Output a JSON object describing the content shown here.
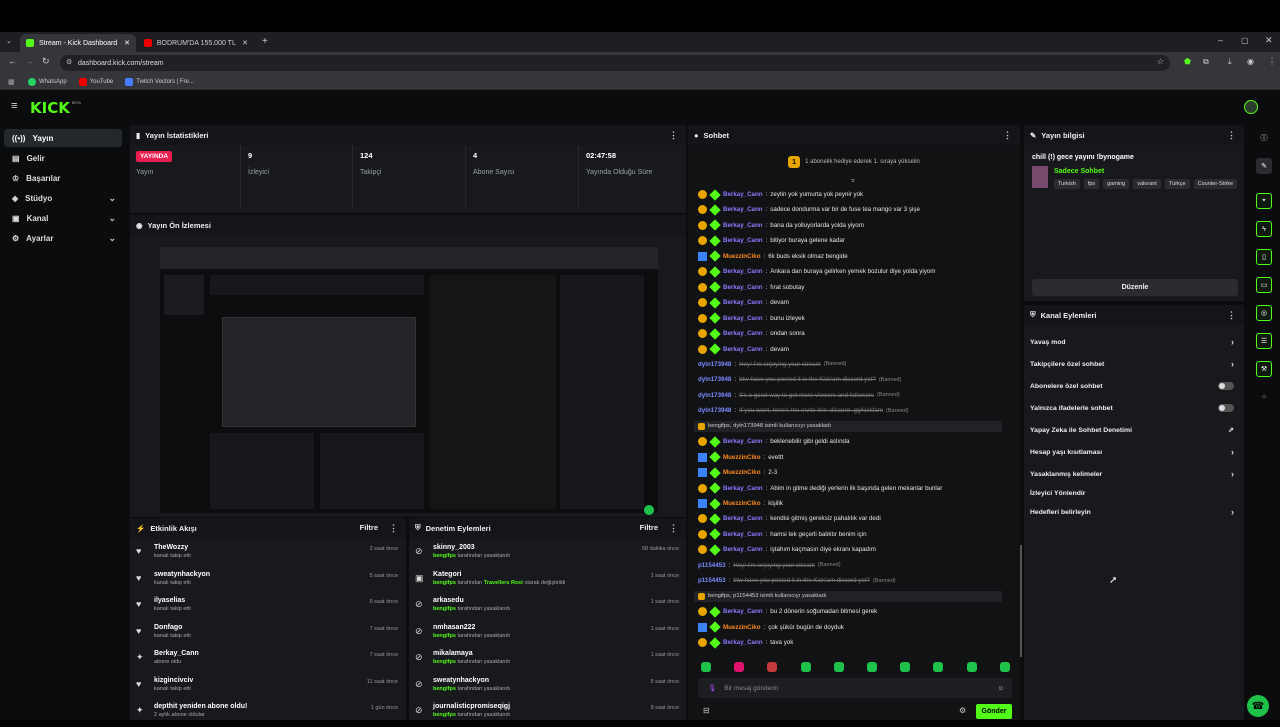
{
  "browser": {
    "tabs": [
      {
        "title": "Stream - Kick Dashboard"
      },
      {
        "title": "BODRUM'DA 155.000 TL HESA..."
      }
    ],
    "url": "dashboard.kick.com/stream",
    "bookmarks": [
      "WhatsApp",
      "YouTube",
      "Twitch Vectors | Fre..."
    ]
  },
  "app": {
    "logo": "KICK",
    "logo_badge": "BETA"
  },
  "sidebar": {
    "items": [
      {
        "label": "Yayın",
        "icon": "radio-icon",
        "active": true
      },
      {
        "label": "Gelir",
        "icon": "wallet-icon"
      },
      {
        "label": "Başarılar",
        "icon": "trophy-icon"
      },
      {
        "label": "Stüdyo",
        "icon": "studio-icon",
        "chevron": true
      },
      {
        "label": "Kanal",
        "icon": "channel-icon",
        "chevron": true
      },
      {
        "label": "Ayarlar",
        "icon": "gear-icon",
        "chevron": true
      }
    ]
  },
  "stats": {
    "title": "Yayın İstatistikleri",
    "items": [
      {
        "value": "YAYINDA",
        "label": "Yayın"
      },
      {
        "value": "9",
        "label": "İzleyici"
      },
      {
        "value": "124",
        "label": "Takipçi"
      },
      {
        "value": "4",
        "label": "Abone Sayısı"
      },
      {
        "value": "02:47:58",
        "label": "Yayında Olduğu Süre"
      }
    ]
  },
  "preview": {
    "title": "Yayın Ön İzlemesi"
  },
  "activity": {
    "title": "Etkinlik Akışı",
    "filter": "Filtre",
    "items": [
      {
        "name": "TheWozzy",
        "sub": "kanalı takip etti",
        "time": "2 saat önce",
        "icon": "heart-icon"
      },
      {
        "name": "sweatynhackyon",
        "sub": "kanalı takip etti",
        "time": "5 saat önce",
        "icon": "heart-icon"
      },
      {
        "name": "ilyaselias",
        "sub": "kanalı takip etti",
        "time": "6 saat önce",
        "icon": "heart-icon"
      },
      {
        "name": "Donfago",
        "sub": "kanalı takip etti",
        "time": "7 saat önce",
        "icon": "heart-icon"
      },
      {
        "name": "Berkay_Cann",
        "sub": "abone oldu",
        "time": "7 saat önce",
        "icon": "star-icon"
      },
      {
        "name": "kizgincivciv",
        "sub": "kanalı takip etti",
        "time": "11 saat önce",
        "icon": "heart-icon"
      },
      {
        "name": "depthit yeniden abone oldu!",
        "sub": "2 aylık abone oldular",
        "time": "1 gün önce",
        "icon": "star-icon"
      }
    ]
  },
  "moderation": {
    "title": "Denetim Eylemleri",
    "filter": "Filtre",
    "items": [
      {
        "name": "skinny_2003",
        "actor": "bengifps",
        "sub": "tarafından yasaklandı",
        "time": "58 dakika önce",
        "icon": "ban-icon"
      },
      {
        "name": "Kategori",
        "actor": "bengifps",
        "sub": "tarafından",
        "extra": "Travellers Rest",
        "sub2": "olarak değiştirildi",
        "time": "1 saat önce",
        "icon": "category-icon"
      },
      {
        "name": "arkasedu",
        "actor": "bengifps",
        "sub": "tarafından yasaklandı",
        "time": "1 saat önce",
        "icon": "ban-icon"
      },
      {
        "name": "nmhasan222",
        "actor": "bengifps",
        "sub": "tarafından yasaklandı",
        "time": "1 saat önce",
        "icon": "ban-icon"
      },
      {
        "name": "mikalamaya",
        "actor": "bengifps",
        "sub": "tarafından yasaklandı",
        "time": "1 saat önce",
        "icon": "ban-icon"
      },
      {
        "name": "sweatynhackyon",
        "actor": "bengifps",
        "sub": "tarafından yasaklandı",
        "time": "5 saat önce",
        "icon": "ban-icon"
      },
      {
        "name": "journalisticpromiseqigj",
        "actor": "bengifps",
        "sub": "tarafından yasaklandı",
        "time": "8 saat önce",
        "icon": "ban-icon"
      }
    ]
  },
  "chat": {
    "title": "Sohbet",
    "banner": "1 abonelik hediye ederek 1. sıraya yükselin",
    "banner_rank": "1",
    "messages": [
      {
        "user": "Berkay_Cann",
        "color": "#8c79ff",
        "text": "zeytin yok yumurta yok peynir yok",
        "badges": "sub"
      },
      {
        "user": "Berkay_Cann",
        "color": "#8c79ff",
        "text": "sadece dondurma var bir de fuse tea mango var 3 şişe",
        "badges": "sub"
      },
      {
        "user": "Berkay_Cann",
        "color": "#8c79ff",
        "text": "bana da yolluyorlarda yolda yiyom",
        "badges": "sub"
      },
      {
        "user": "Berkay_Cann",
        "color": "#8c79ff",
        "text": "bitiyor buraya gelene kadar",
        "badges": "sub"
      },
      {
        "user": "MuezzinCiko",
        "color": "#ff8a1e",
        "text": "6lı buds eksik olmaz bengide",
        "badges": "mod"
      },
      {
        "user": "Berkay_Cann",
        "color": "#8c79ff",
        "text": "Ankara dan buraya gelirken yemek bozulur diye yolda yiyom",
        "badges": "sub"
      },
      {
        "user": "Berkay_Cann",
        "color": "#8c79ff",
        "text": "fırat sobutay",
        "badges": "sub"
      },
      {
        "user": "Berkay_Cann",
        "color": "#8c79ff",
        "text": "devam",
        "badges": "sub"
      },
      {
        "user": "Berkay_Cann",
        "color": "#8c79ff",
        "text": "bunu izleyek",
        "badges": "sub"
      },
      {
        "user": "Berkay_Cann",
        "color": "#8c79ff",
        "text": "ondan sonra",
        "badges": "sub"
      },
      {
        "user": "Berkay_Cann",
        "color": "#8c79ff",
        "text": "devam",
        "badges": "sub"
      },
      {
        "user": "dyln173948",
        "color": "#7c8cff",
        "text": "Hey! I'm enjoying your stream",
        "banned": "(Banned)"
      },
      {
        "user": "dyln173948",
        "color": "#7c8cff",
        "text": "btw have you posted it in the Kick'am discord yet?",
        "banned": "(Banned)"
      },
      {
        "user": "dyln173948",
        "color": "#7c8cff",
        "text": "It's a good way to get more viewers and followers",
        "banned": "(Banned)"
      },
      {
        "user": "dyln173948",
        "color": "#7c8cff",
        "text": "If you want, here's the invite link: discord .gg/kickfam",
        "banned": "(Banned)"
      },
      {
        "system": "bengifps, dyln173948 isimli kullanıcıyı yasakladı"
      },
      {
        "user": "Berkay_Cann",
        "color": "#8c79ff",
        "text": "beklenebilir gibi geldi aslında",
        "badges": "sub"
      },
      {
        "user": "MuezzinCiko",
        "color": "#ff8a1e",
        "text": "evettt",
        "badges": "mod"
      },
      {
        "user": "MuezzinCiko",
        "color": "#ff8a1e",
        "text": "2-3",
        "badges": "mod"
      },
      {
        "user": "Berkay_Cann",
        "color": "#8c79ff",
        "text": "Abim in gitme dediği yerlerin ilk başında gelen mekanlar bunlar",
        "badges": "sub"
      },
      {
        "user": "MuezzinCiko",
        "color": "#ff8a1e",
        "text": "kişilik",
        "badges": "mod"
      },
      {
        "user": "Berkay_Cann",
        "color": "#8c79ff",
        "text": "kendisi gitmiş gereksiz pahalılık var dedi",
        "badges": "sub"
      },
      {
        "user": "Berkay_Cann",
        "color": "#8c79ff",
        "text": "hamsi tek geçerli balıktır benim için",
        "badges": "sub"
      },
      {
        "user": "Berkay_Cann",
        "color": "#8c79ff",
        "text": "iştahım kaçmasın diye ekranı kapadım",
        "badges": "sub"
      },
      {
        "user": "p1154453",
        "color": "#7c8cff",
        "text": "Hey! I'm enjoying your stream",
        "banned": "(Banned)"
      },
      {
        "user": "p1154453",
        "color": "#7c8cff",
        "text": "btw have you posted it in the Kick'am discord yet?",
        "banned": "(Banned)"
      },
      {
        "system": "bengifps, p1154453 isimli kullanıcıyı yasakladı"
      },
      {
        "user": "Berkay_Cann",
        "color": "#8c79ff",
        "text": "bu 2 dönerin soğumadan bitmesi gerek",
        "badges": "sub"
      },
      {
        "user": "MuezzinCiko",
        "color": "#ff8a1e",
        "text": "çok şükür bugün de doyduk",
        "badges": "mod"
      },
      {
        "user": "Berkay_Cann",
        "color": "#8c79ff",
        "text": "tava yok",
        "badges": "sub"
      }
    ],
    "input_placeholder": "Bir mesaj gönderin",
    "send": "Gönder"
  },
  "stream_info": {
    "title": "Yayın bilgisi",
    "stream_title": "chill (!) gece yayını !bynogame",
    "category": "Sadece Sohbet",
    "tags": [
      "Turkish",
      "fps",
      "gaming",
      "valorant",
      "Türkçe",
      "Counter-Strike"
    ],
    "edit": "Düzenle"
  },
  "channel_actions": {
    "title": "Kanal Eylemleri",
    "items": [
      {
        "label": "Yavaş mod",
        "control": "chevron"
      },
      {
        "label": "Takipçilere özel sohbet",
        "control": "chevron"
      },
      {
        "label": "Abonelere özel sohbet",
        "control": "toggle"
      },
      {
        "label": "Yalnızca ifadelerle sohbet",
        "control": "toggle"
      },
      {
        "label": "Yapay Zeka ile Sohbet Denetimi",
        "control": "external"
      },
      {
        "label": "Hesap yaşı kısıtlaması",
        "control": "chevron"
      },
      {
        "label": "Yasaklanmış kelimeler",
        "control": "chevron"
      },
      {
        "label": "İzleyici Yönlendir",
        "control": "none"
      },
      {
        "label": "Hedefleri belirleyin",
        "control": "chevron"
      }
    ]
  },
  "colors": {
    "accent": "#53fc18",
    "live": "#e91e50",
    "panel": "#18191c"
  }
}
